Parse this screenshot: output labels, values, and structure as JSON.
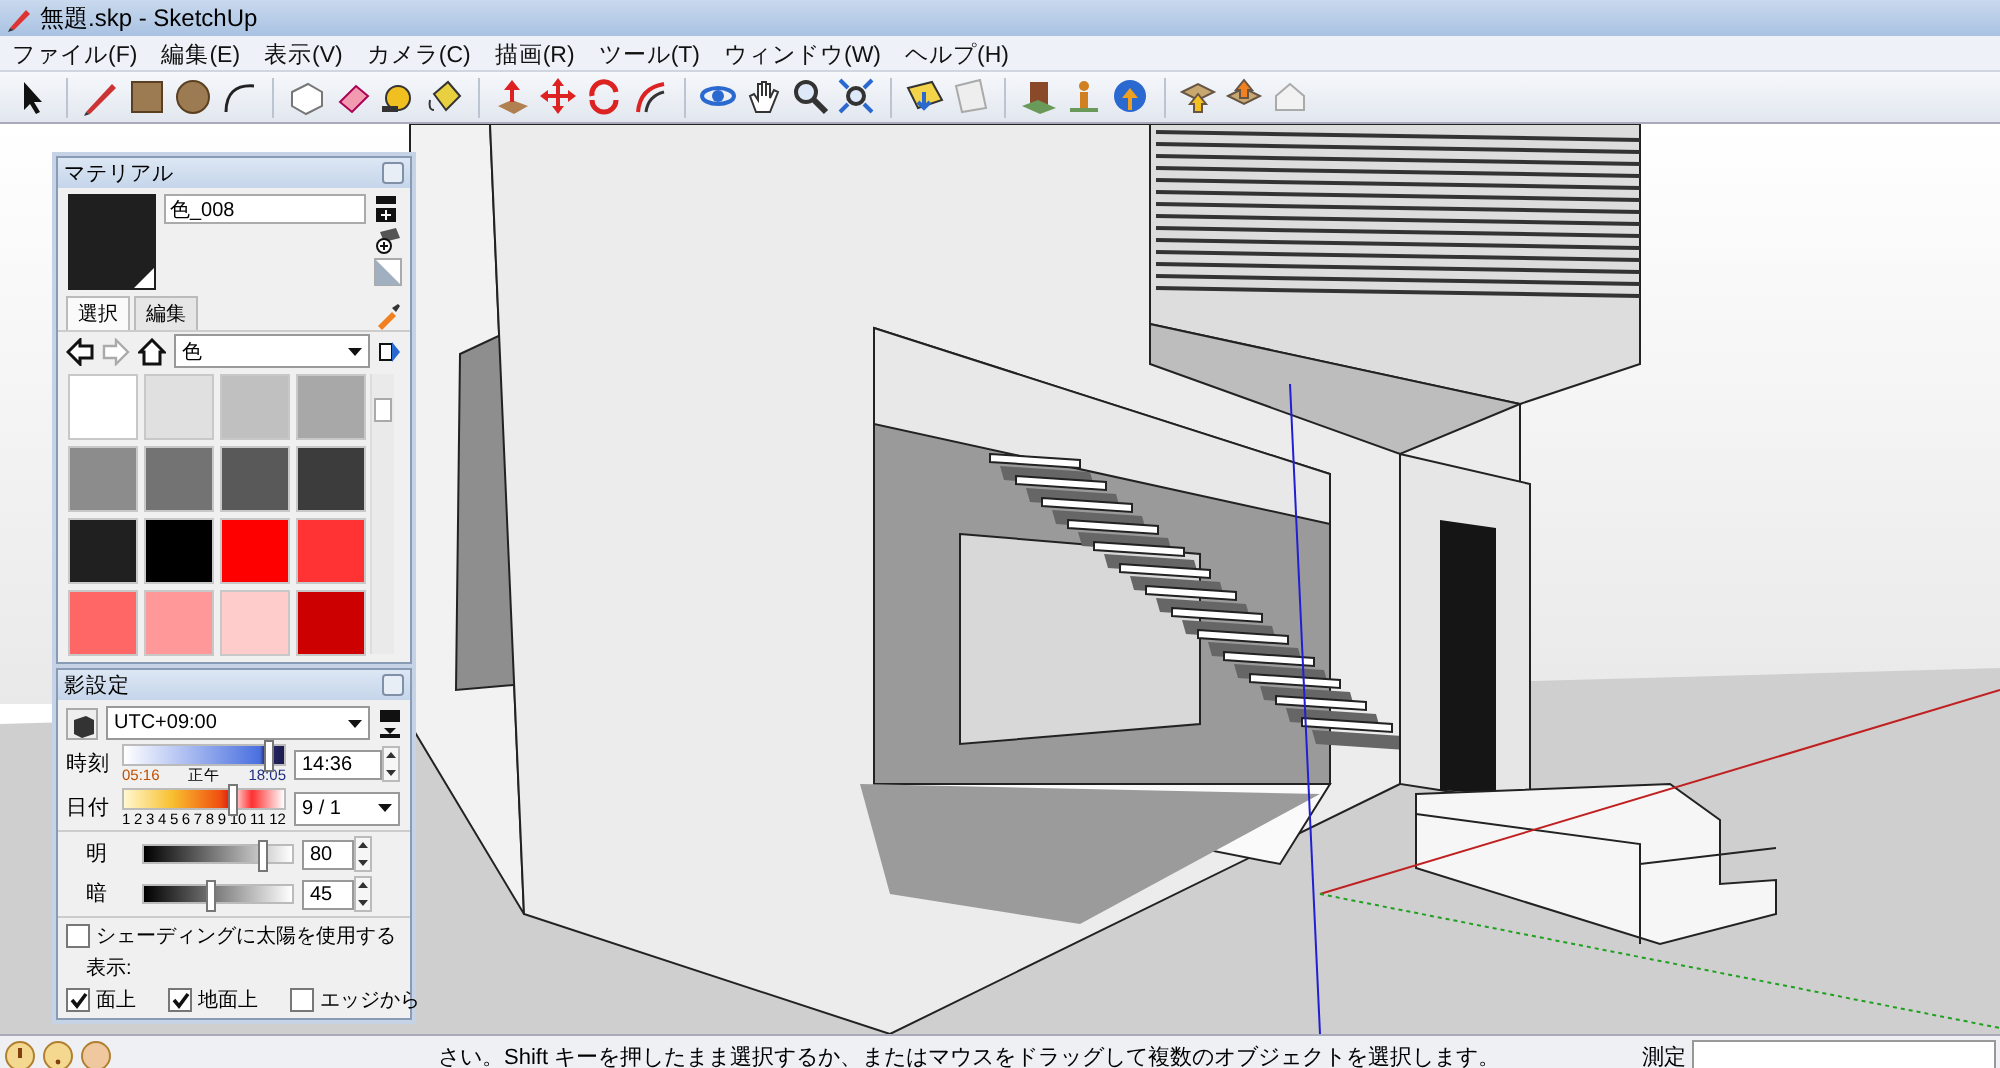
{
  "window": {
    "title": "無題.skp - SketchUp"
  },
  "menu": [
    {
      "label": "ファイル(F)"
    },
    {
      "label": "編集(E)"
    },
    {
      "label": "表示(V)"
    },
    {
      "label": "カメラ(C)"
    },
    {
      "label": "描画(R)"
    },
    {
      "label": "ツール(T)"
    },
    {
      "label": "ウィンドウ(W)"
    },
    {
      "label": "ヘルプ(H)"
    }
  ],
  "material_panel": {
    "title": "マテリアル",
    "material_name": "色_008",
    "tabs": [
      {
        "label": "選択",
        "selected": true
      },
      {
        "label": "編集",
        "selected": false
      }
    ],
    "library": "色",
    "swatches": [
      {
        "color": "#ffffff"
      },
      {
        "color": "#e0e0e0"
      },
      {
        "color": "#c0c0c0"
      },
      {
        "color": "#a8a8a8"
      },
      {
        "color": "#8c8c8c"
      },
      {
        "color": "#737373"
      },
      {
        "color": "#595959"
      },
      {
        "color": "#3c3c3c"
      },
      {
        "color": "#202020"
      },
      {
        "color": "#000000"
      },
      {
        "color": "#ff0000"
      },
      {
        "color": "#ff3333"
      },
      {
        "color": "#ff6666"
      },
      {
        "color": "#ff9999"
      },
      {
        "color": "#ffcccc"
      },
      {
        "color": "#cc0000"
      }
    ]
  },
  "shadow_panel": {
    "title": "影設定",
    "timezone": "UTC+09:00",
    "time": {
      "label": "時刻",
      "start": "05:16",
      "noon": "正午",
      "end": "18:05",
      "level": 0.9,
      "value": "14:36"
    },
    "date": {
      "label": "日付",
      "months": [
        "1",
        "2",
        "3",
        "4",
        "5",
        "6",
        "7",
        "8",
        "9",
        "10",
        "11",
        "12"
      ],
      "level": 0.68,
      "value": "9 / 1"
    },
    "light": {
      "label": "明",
      "level": 0.8,
      "value": "80"
    },
    "dark": {
      "label": "暗",
      "level": 0.45,
      "value": "45"
    },
    "use_sun": {
      "label": "シェーディングに太陽を使用する",
      "checked": false
    },
    "display_label": "表示:",
    "display": [
      {
        "label": "面上",
        "checked": true
      },
      {
        "label": "地面上",
        "checked": true
      },
      {
        "label": "エッジから",
        "checked": false
      }
    ]
  },
  "status_bar": {
    "text": "さい。Shift キーを押したまま選択するか、またはマウスをドラッグして複数のオブジェクトを選択します。",
    "measure_label": "測定"
  }
}
